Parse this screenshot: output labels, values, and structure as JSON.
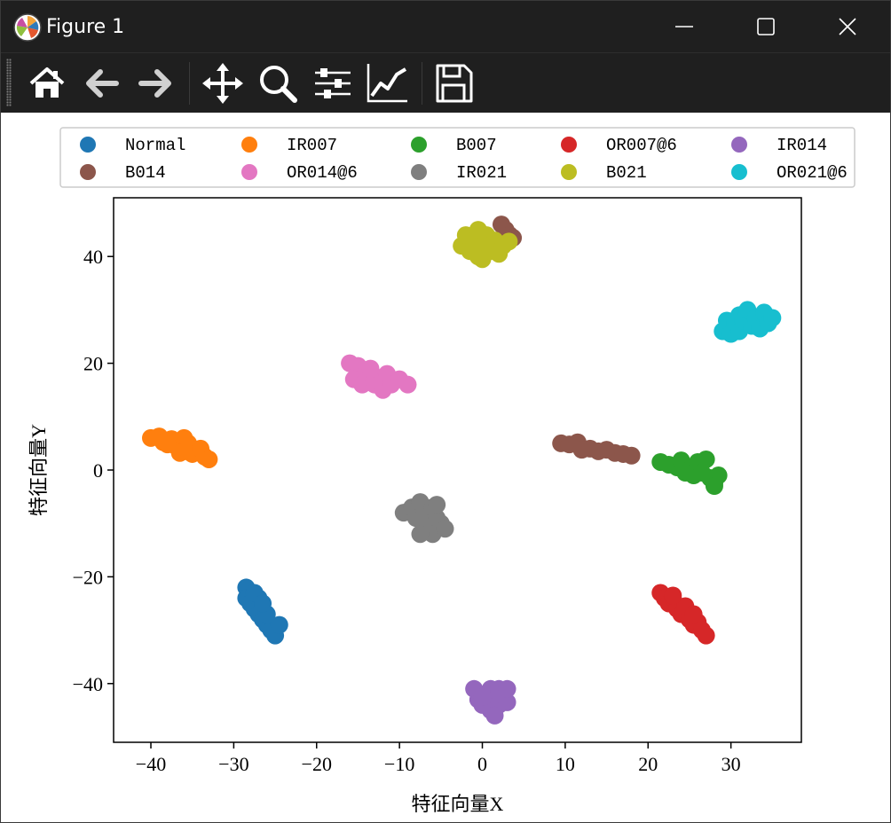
{
  "window": {
    "title": "Figure 1",
    "controls": [
      "minimize",
      "maximize",
      "close"
    ]
  },
  "toolbar": {
    "items": [
      {
        "name": "home-icon",
        "tooltip": "Home"
      },
      {
        "name": "back-arrow-icon",
        "tooltip": "Back"
      },
      {
        "name": "forward-arrow-icon",
        "tooltip": "Forward"
      },
      {
        "name": "pan-icon",
        "tooltip": "Pan"
      },
      {
        "name": "zoom-icon",
        "tooltip": "Zoom"
      },
      {
        "name": "subplots-icon",
        "tooltip": "Subplots"
      },
      {
        "name": "customize-icon",
        "tooltip": "Customize"
      },
      {
        "name": "save-icon",
        "tooltip": "Save"
      }
    ]
  },
  "chart_data": {
    "type": "scatter",
    "title": "",
    "xlabel": "特征向量X",
    "ylabel": "特征向量Y",
    "xlim": [
      -44.5,
      38.5
    ],
    "ylim": [
      -51,
      51
    ],
    "xticks": [
      -40,
      -30,
      -20,
      -10,
      0,
      10,
      20,
      30
    ],
    "yticks": [
      -40,
      -20,
      0,
      20,
      40
    ],
    "xtick_labels": [
      "−40",
      "−30",
      "−20",
      "−10",
      "0",
      "10",
      "20",
      "30"
    ],
    "ytick_labels": [
      "−40",
      "−20",
      "0",
      "20",
      "40"
    ],
    "grid": false,
    "legend_position": "above-plot",
    "legend_columns": 5,
    "series": [
      {
        "name": "Normal",
        "color": "#1f77b4",
        "points": [
          [
            -28.5,
            -22
          ],
          [
            -28.5,
            -24
          ],
          [
            -28,
            -25
          ],
          [
            -27.5,
            -26
          ],
          [
            -27,
            -24
          ],
          [
            -27,
            -27
          ],
          [
            -26.5,
            -28
          ],
          [
            -26,
            -29
          ],
          [
            -25.5,
            -30
          ],
          [
            -25,
            -31
          ],
          [
            -24.5,
            -29
          ],
          [
            -26,
            -27
          ],
          [
            -27.5,
            -23
          ],
          [
            -26.5,
            -25
          ]
        ]
      },
      {
        "name": "IR007",
        "color": "#ff7f0e",
        "points": [
          [
            -40,
            6
          ],
          [
            -39,
            6.3
          ],
          [
            -38.5,
            5.2
          ],
          [
            -37.5,
            5.8
          ],
          [
            -37,
            4.5
          ],
          [
            -36,
            6
          ],
          [
            -36,
            3.5
          ],
          [
            -35.5,
            5
          ],
          [
            -35,
            3
          ],
          [
            -34,
            4
          ],
          [
            -33.5,
            2.5
          ],
          [
            -33,
            2
          ],
          [
            -38,
            4.8
          ],
          [
            -36.5,
            3.2
          ]
        ]
      },
      {
        "name": "B007",
        "color": "#2ca02c",
        "points": [
          [
            21.5,
            1.5
          ],
          [
            22.5,
            1
          ],
          [
            23.5,
            0.5
          ],
          [
            24,
            1.8
          ],
          [
            25,
            0
          ],
          [
            25.5,
            -1
          ],
          [
            26,
            1.5
          ],
          [
            26.5,
            -0.5
          ],
          [
            27,
            2
          ],
          [
            27.5,
            -1.5
          ],
          [
            28,
            -2.5
          ],
          [
            28.5,
            -1
          ],
          [
            28,
            -3
          ],
          [
            24.5,
            -0.5
          ]
        ]
      },
      {
        "name": "OR007@6",
        "color": "#d62728",
        "points": [
          [
            21.5,
            -23
          ],
          [
            22,
            -24
          ],
          [
            22.5,
            -25
          ],
          [
            23,
            -24
          ],
          [
            23.5,
            -26
          ],
          [
            24,
            -27
          ],
          [
            24.5,
            -25.5
          ],
          [
            25,
            -28
          ],
          [
            25.5,
            -29
          ],
          [
            26,
            -28.5
          ],
          [
            26.5,
            -30
          ],
          [
            27,
            -31
          ],
          [
            23,
            -23.5
          ],
          [
            25.5,
            -27
          ]
        ]
      },
      {
        "name": "IR014",
        "color": "#9467bd",
        "points": [
          [
            -1,
            -41
          ],
          [
            -0.5,
            -43
          ],
          [
            0,
            -44
          ],
          [
            0.5,
            -42
          ],
          [
            1,
            -45
          ],
          [
            1,
            -41
          ],
          [
            1.5,
            -43
          ],
          [
            2,
            -44
          ],
          [
            2,
            -41
          ],
          [
            2.5,
            -42
          ],
          [
            3,
            -43.5
          ],
          [
            3,
            -41
          ],
          [
            1.5,
            -46
          ],
          [
            0,
            -42.5
          ]
        ]
      },
      {
        "name": "B014",
        "color": "#8c564b",
        "points": [
          [
            2.3,
            46
          ],
          [
            2.8,
            45
          ],
          [
            3.3,
            44
          ],
          [
            3.7,
            43.5
          ],
          [
            9.5,
            5
          ],
          [
            10.5,
            4.8
          ],
          [
            11.5,
            5.2
          ],
          [
            12,
            3.8
          ],
          [
            13,
            4
          ],
          [
            14,
            3.5
          ],
          [
            15,
            3.8
          ],
          [
            16,
            3.2
          ],
          [
            17,
            3
          ],
          [
            18,
            2.7
          ]
        ]
      },
      {
        "name": "OR014@6",
        "color": "#e377c2",
        "points": [
          [
            -16,
            20
          ],
          [
            -15,
            19.5
          ],
          [
            -15.5,
            17
          ],
          [
            -14.5,
            16
          ],
          [
            -14,
            18.5
          ],
          [
            -13,
            17.5
          ],
          [
            -13,
            16
          ],
          [
            -12,
            17
          ],
          [
            -12,
            15
          ],
          [
            -11.5,
            18
          ],
          [
            -11,
            16
          ],
          [
            -10,
            17
          ],
          [
            -9,
            16
          ],
          [
            -13.5,
            19
          ]
        ]
      },
      {
        "name": "IR021",
        "color": "#7f7f7f",
        "points": [
          [
            -9.5,
            -8
          ],
          [
            -8.5,
            -7
          ],
          [
            -8,
            -9
          ],
          [
            -7.5,
            -6
          ],
          [
            -7,
            -8
          ],
          [
            -7,
            -11
          ],
          [
            -6.5,
            -10
          ],
          [
            -6,
            -12
          ],
          [
            -6,
            -7
          ],
          [
            -5.5,
            -9
          ],
          [
            -5,
            -10
          ],
          [
            -4.5,
            -11
          ],
          [
            -7.5,
            -12
          ],
          [
            -5.5,
            -6.5
          ]
        ]
      },
      {
        "name": "B021",
        "color": "#bcbd22",
        "points": [
          [
            -2.5,
            42
          ],
          [
            -2,
            44
          ],
          [
            -1.5,
            41
          ],
          [
            -1,
            43
          ],
          [
            -0.5,
            45
          ],
          [
            -0.5,
            40
          ],
          [
            0,
            42
          ],
          [
            0,
            39.5
          ],
          [
            0.5,
            44
          ],
          [
            1,
            41
          ],
          [
            1.5,
            43
          ],
          [
            2,
            40.5
          ],
          [
            2.5,
            42
          ],
          [
            3.2,
            42.8
          ]
        ]
      },
      {
        "name": "OR021@6",
        "color": "#17becf",
        "points": [
          [
            29,
            26
          ],
          [
            29.5,
            28
          ],
          [
            30,
            25.5
          ],
          [
            30.5,
            27.5
          ],
          [
            31,
            29
          ],
          [
            31,
            26
          ],
          [
            31.5,
            28
          ],
          [
            32,
            30
          ],
          [
            32.5,
            27
          ],
          [
            33,
            28.5
          ],
          [
            33.5,
            26.5
          ],
          [
            34,
            29.5
          ],
          [
            34.5,
            27.5
          ],
          [
            35,
            28.5
          ]
        ]
      }
    ]
  }
}
